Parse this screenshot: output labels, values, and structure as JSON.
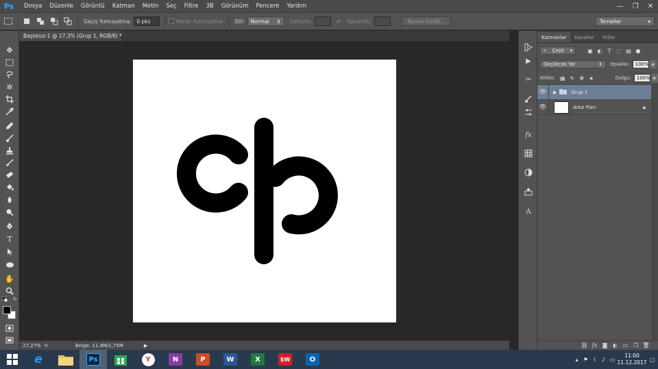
{
  "app": {
    "logo": "Ps"
  },
  "menu": [
    "Dosya",
    "Düzenle",
    "Görüntü",
    "Katman",
    "Metin",
    "Seç",
    "Filtre",
    "3B",
    "Görünüm",
    "Pencere",
    "Yardım"
  ],
  "window_controls": {
    "minimize": "—",
    "restore": "❐",
    "close": "✕"
  },
  "options_bar": {
    "feather_label": "Geçiş Yumuşatma:",
    "feather_value": "0 pks",
    "antialias_label": "Kenar Yumuşatma",
    "style_label": "Stil:",
    "style_value": "Normal",
    "width_label": "Genişlik:",
    "height_label": "Yükseklik:",
    "refine_edge_button": "Kenarı İncelt...",
    "workspace": "Temeller"
  },
  "document": {
    "tab_title": "Başlıksız-1 @ 27,3% (Grup 1, RGB/8) *",
    "tab_close": "×"
  },
  "status_bar": {
    "zoom": "27,27%",
    "doc_info": "Belge: 11,4M/1,75M"
  },
  "layers_panel": {
    "tabs": [
      "Katmanlar",
      "Kanallar",
      "Yollar"
    ],
    "filter_kind": "Çeşit",
    "blend_mode": "Geçilecek Yer",
    "opacity_label": "Opaklık:",
    "opacity_value": "100%",
    "lock_label": "Kilitle:",
    "fill_label": "Dolgu:",
    "fill_value": "100%",
    "layers": [
      {
        "name": "Grup 1",
        "type": "group",
        "selected": true
      },
      {
        "name": "Arka Plan",
        "type": "background",
        "locked": true
      }
    ]
  },
  "taskbar": {
    "apps": [
      {
        "name": "start",
        "glyph": "⊞"
      },
      {
        "name": "internet-explorer",
        "glyph": "e",
        "color": "#1f8fe0"
      },
      {
        "name": "file-explorer",
        "glyph": "▭",
        "color": "#e8c25a"
      },
      {
        "name": "photoshop",
        "glyph": "Ps",
        "color": "#0b2641",
        "active": true
      },
      {
        "name": "store",
        "glyph": "▦",
        "color": "#2da84a"
      },
      {
        "name": "yandex-browser",
        "glyph": "Y",
        "color": "#e8302f"
      },
      {
        "name": "onenote",
        "glyph": "N",
        "color": "#8b3aa6"
      },
      {
        "name": "powerpoint",
        "glyph": "P",
        "color": "#cf4a26"
      },
      {
        "name": "word",
        "glyph": "W",
        "color": "#2b5797"
      },
      {
        "name": "excel",
        "glyph": "X",
        "color": "#1f7a3d"
      },
      {
        "name": "solidworks",
        "glyph": "SW",
        "color": "#d0202a"
      },
      {
        "name": "outlook",
        "glyph": "O",
        "color": "#0a64b4"
      }
    ],
    "clock_time": "11:00",
    "clock_date": "11.12.2017"
  },
  "colors": {
    "menu_bg": "#4a4a4a",
    "panel_bg": "#535353",
    "pasteboard": "#282828",
    "canvas": "#ffffff",
    "selection": "#6c7f95",
    "taskbar": "#2a3a4e",
    "ps_blue": "#31a8ff"
  }
}
